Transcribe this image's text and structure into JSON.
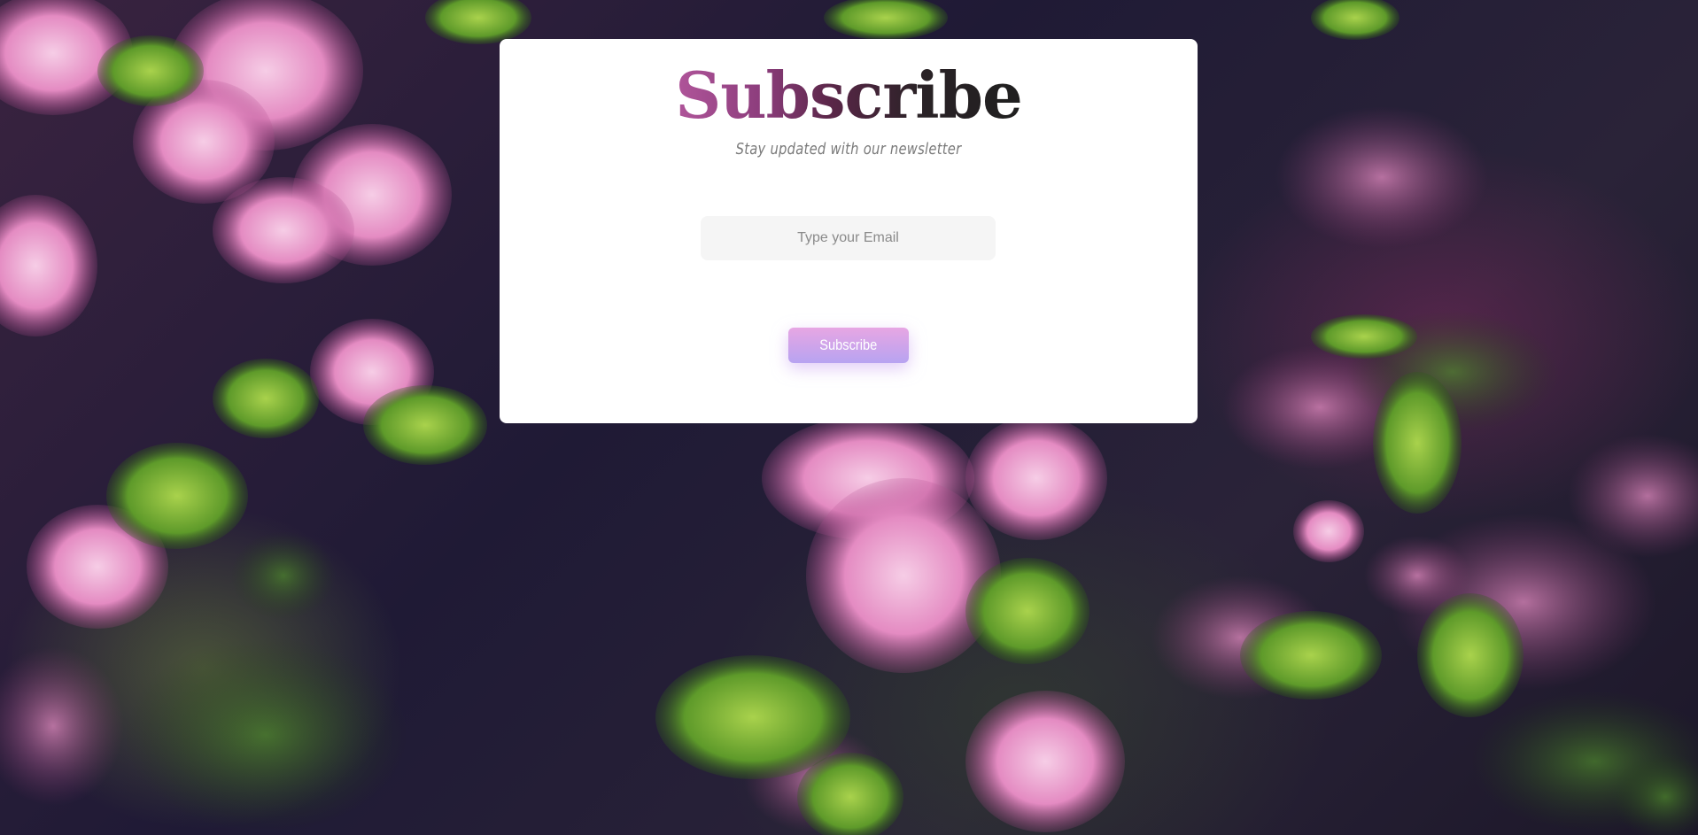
{
  "card": {
    "title": "Subscribe",
    "subtitle": "Stay updated with our newsletter",
    "email_placeholder": "Type your Email",
    "email_value": "",
    "button_label": "Subscribe"
  },
  "colors": {
    "card_background": "#ffffff",
    "title_gradient_start": "#b0559a",
    "title_gradient_end": "#1f1f1f",
    "button_gradient_start": "#e7a6e3",
    "button_gradient_end": "#b7a3f1",
    "input_background": "#f5f5f5"
  },
  "background": {
    "image": "pink-blossom-photo"
  }
}
